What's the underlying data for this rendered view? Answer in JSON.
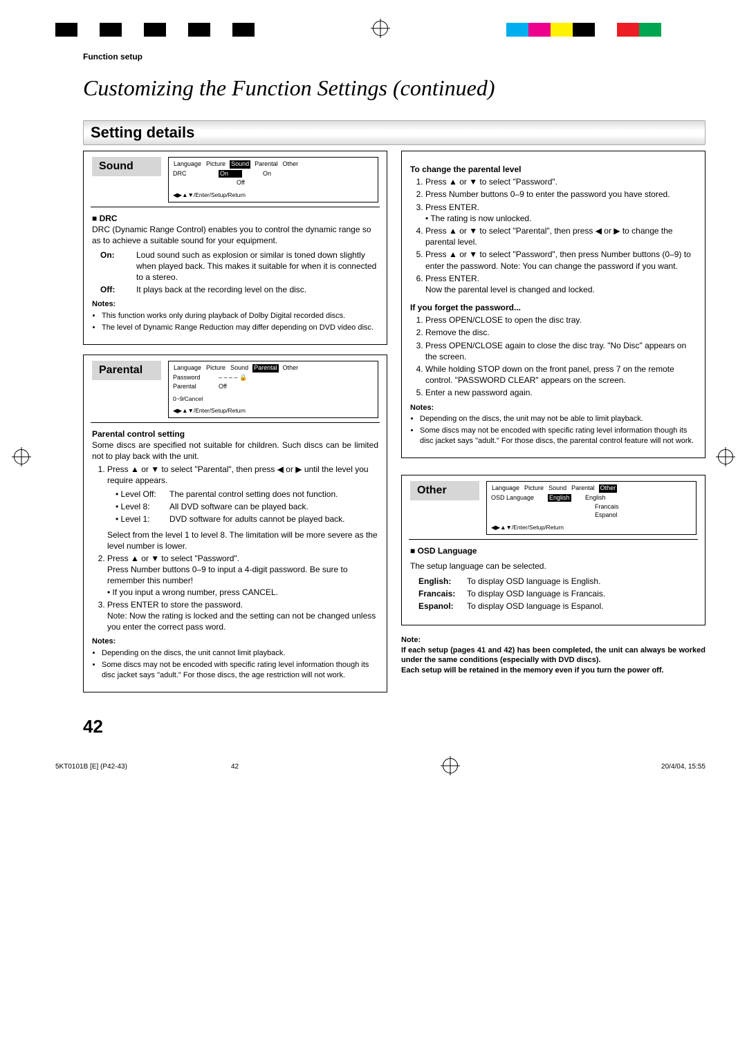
{
  "regrow": {
    "left_colors": [
      "#000",
      "#000",
      "#000",
      "#000",
      "#000"
    ],
    "right_colors": [
      "#00aeef",
      "#ed008c",
      "#fff200",
      "#000",
      "#ec1c24",
      "#00a551",
      "#fff",
      "#fff",
      "#000"
    ]
  },
  "header_label": "Function setup",
  "page_title": "Customizing the Function Settings (continued)",
  "section_bar": "Setting details",
  "sound": {
    "title": "Sound",
    "osd": {
      "tabs": [
        "Language",
        "Picture",
        "Sound",
        "Parental",
        "Other"
      ],
      "selected_tab": "Sound",
      "rows": [
        {
          "k": "DRC",
          "v": "On",
          "opts": [
            "On",
            "Off"
          ],
          "sel": "On"
        }
      ],
      "foot": "◀▶▲▼/Enter/Setup/Return"
    },
    "drc_head": "DRC",
    "drc_body": "DRC (Dynamic Range Control) enables you to control the dynamic range so as to achieve a suitable sound for your equipment.",
    "on_label": "On:",
    "on_text": "Loud sound such as explosion or similar is toned down slightly when played back. This makes it suitable for when it is connected to a stereo.",
    "off_label": "Off:",
    "off_text": "It plays back at the recording level on the disc.",
    "notes_head": "Notes:",
    "notes": [
      "This function works only during playback of Dolby Digital recorded discs.",
      "The level of Dynamic Range Reduction may differ depending on DVD video disc."
    ]
  },
  "parental": {
    "title": "Parental",
    "osd": {
      "tabs": [
        "Language",
        "Picture",
        "Sound",
        "Parental",
        "Other"
      ],
      "selected_tab": "Parental",
      "rows": [
        {
          "k": "Password",
          "v": "– – – – 🔒"
        },
        {
          "k": "Parental",
          "v": "Off"
        }
      ],
      "extra": "0~9/Cancel",
      "foot": "◀▶▲▼/Enter/Setup/Return"
    },
    "pcs_head": "Parental control setting",
    "pcs_body": "Some discs are specified not suitable for children. Such discs can be limited not to play back with the unit.",
    "steps": [
      {
        "pre": "Press ▲ or ▼ to select \"Parental\", then press ◀ or ▶ until the level you require appears.",
        "levels": [
          {
            "k": "• Level Off:",
            "v": "The parental control setting does not function."
          },
          {
            "k": "• Level 8:",
            "v": "All DVD software can be played back."
          },
          {
            "k": "• Level 1:",
            "v": "DVD software for adults cannot be played back."
          }
        ],
        "post": "Select from the level 1 to level 8. The limitation will be more severe as the level number is lower."
      },
      {
        "pre": "Press ▲ or ▼ to select \"Password\".",
        "lines": [
          "Press Number buttons 0–9 to input a 4-digit password. Be sure to remember this number!",
          "• If you input a wrong number, press CANCEL."
        ]
      },
      {
        "pre": "Press ENTER to store the password.",
        "lines": [
          "Note: Now the rating is locked and the setting can not be changed unless you enter the correct pass word."
        ]
      }
    ],
    "notes_head": "Notes:",
    "notes": [
      "Depending on the discs, the unit cannot limit playback.",
      "Some discs may not be encoded with specific rating level information though its disc jacket says \"adult.\" For those discs, the age restriction will not work."
    ]
  },
  "change_level": {
    "head": "To change the parental level",
    "items": [
      "Press ▲ or ▼ to select \"Password\".",
      "Press Number buttons 0–9 to enter the password you have stored.",
      "Press ENTER.\n• The rating is now unlocked.",
      "Press ▲ or ▼ to select \"Parental\", then press ◀ or ▶ to change the parental level.",
      "Press ▲ or ▼ to select \"Password\", then press Number buttons (0–9) to enter the password. Note: You can change the password if you want.",
      "Press ENTER.\nNow the parental level is changed and locked."
    ]
  },
  "forget": {
    "head": "If you forget the password...",
    "items": [
      "Press OPEN/CLOSE to open the disc tray.",
      "Remove the disc.",
      "Press OPEN/CLOSE again to close the disc tray. \"No Disc\" appears on the screen.",
      "While holding STOP down on the front panel, press 7 on the remote control. \"PASSWORD CLEAR\" appears on the screen.",
      "Enter a new password again."
    ],
    "notes_head": "Notes:",
    "notes": [
      "Depending on the discs, the unit may not be able to limit playback.",
      "Some discs may not be encoded with specific rating level information though its disc jacket says \"adult.\" For those discs, the parental control feature will not work."
    ]
  },
  "other": {
    "title": "Other",
    "osd": {
      "tabs": [
        "Language",
        "Picture",
        "Sound",
        "Parental",
        "Other"
      ],
      "selected_tab": "Other",
      "rows": [
        {
          "k": "OSD Language",
          "v": "English",
          "opts": [
            "English",
            "Francais",
            "Espanol"
          ],
          "sel": "English"
        }
      ],
      "foot": "◀▶▲▼/Enter/Setup/Return"
    },
    "osdlang_head": "OSD Language",
    "osdlang_body": "The setup language can be selected.",
    "langs": [
      {
        "k": "English:",
        "v": "To display OSD language is English."
      },
      {
        "k": "Francais:",
        "v": "To display OSD language is Francais."
      },
      {
        "k": "Espanol:",
        "v": "To display OSD language is Espanol."
      }
    ],
    "note_head": "Note:",
    "note_body": "If each setup (pages 41 and 42) has been completed, the unit can always be worked under the same conditions (especially with DVD discs).\nEach setup will be retained in the memory even if you turn the power off."
  },
  "page_number": "42",
  "footer": {
    "left": "5KT0101B [E] (P42-43)",
    "mid": "42",
    "right": "20/4/04, 15:55"
  }
}
